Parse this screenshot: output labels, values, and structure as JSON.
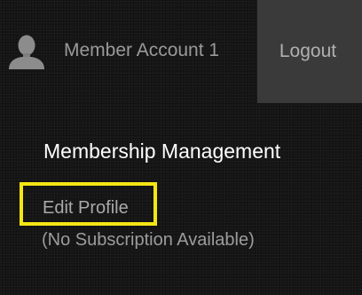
{
  "header": {
    "account_name": "Member Account 1",
    "logout_label": "Logout",
    "avatar_icon": "user-silhouette-icon"
  },
  "main": {
    "section_title": "Membership Management",
    "edit_profile_label": "Edit Profile",
    "subscription_status": "(No Subscription Available)"
  },
  "colors": {
    "background": "#151515",
    "logout_bg": "#3a3a3a",
    "highlight": "#f5e614",
    "title_text": "#ffffff",
    "muted_text": "#9a9a9a"
  }
}
